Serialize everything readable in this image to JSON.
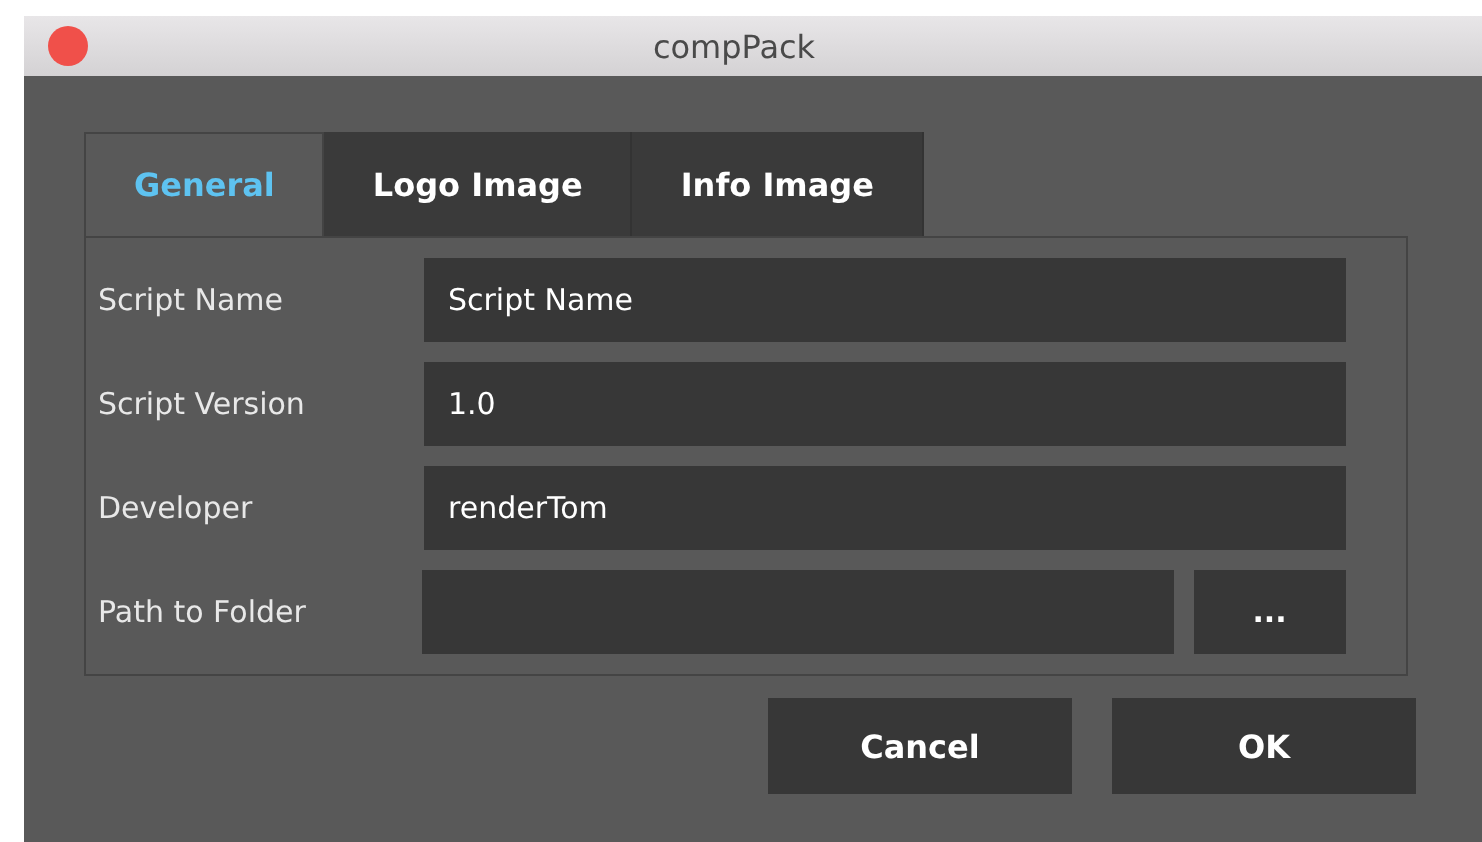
{
  "window": {
    "title": "compPack"
  },
  "tabs": [
    {
      "label": "General",
      "selected": true
    },
    {
      "label": "Logo Image",
      "selected": false
    },
    {
      "label": "Info Image",
      "selected": false
    }
  ],
  "fields": [
    {
      "kind": "text",
      "label": "Script Name",
      "value": "Script Name"
    },
    {
      "kind": "text",
      "label": "Script Version",
      "value": "1.0"
    },
    {
      "kind": "text",
      "label": "Developer",
      "value": "renderTom"
    },
    {
      "kind": "folder",
      "label": "Path to Folder",
      "browse": "..."
    }
  ],
  "buttons": [
    "Cancel",
    "OK"
  ]
}
